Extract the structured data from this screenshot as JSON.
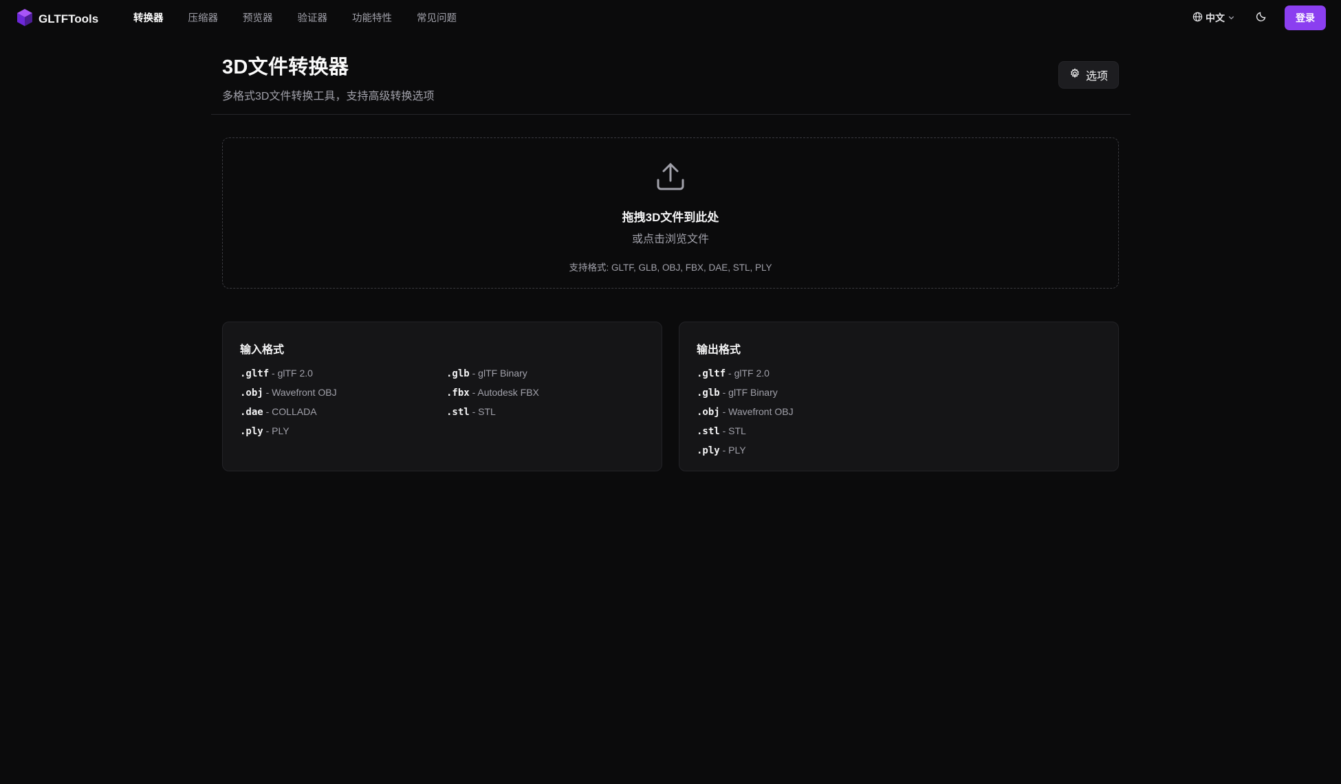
{
  "nav": {
    "brand": "GLTFTools",
    "links": [
      "转换器",
      "压缩器",
      "预览器",
      "验证器",
      "功能特性",
      "常见问题"
    ],
    "language": "中文",
    "login": "登录"
  },
  "header": {
    "title": "3D文件转换器",
    "subtitle": "多格式3D文件转换工具，支持高级转换选项",
    "options_label": "选项"
  },
  "dropzone": {
    "title": "拖拽3D文件到此处",
    "subtitle": "或点击浏览文件",
    "formats": "支持格式: GLTF, GLB, OBJ, FBX, DAE, STL, PLY"
  },
  "input_formats": {
    "title": "输入格式",
    "items": [
      {
        "ext": ".gltf",
        "desc": "glTF 2.0"
      },
      {
        "ext": ".glb",
        "desc": "glTF Binary"
      },
      {
        "ext": ".obj",
        "desc": "Wavefront OBJ"
      },
      {
        "ext": ".fbx",
        "desc": "Autodesk FBX"
      },
      {
        "ext": ".dae",
        "desc": "COLLADA"
      },
      {
        "ext": ".stl",
        "desc": "STL"
      },
      {
        "ext": ".ply",
        "desc": "PLY"
      }
    ]
  },
  "output_formats": {
    "title": "输出格式",
    "items": [
      {
        "ext": ".gltf",
        "desc": "glTF 2.0"
      },
      {
        "ext": ".glb",
        "desc": "glTF Binary"
      },
      {
        "ext": ".obj",
        "desc": "Wavefront OBJ"
      },
      {
        "ext": ".stl",
        "desc": "STL"
      },
      {
        "ext": ".ply",
        "desc": "PLY"
      }
    ]
  },
  "icons": {
    "logo": "cube-logo-icon",
    "language": "globe-icon",
    "dropdown": "chevron-down-icon",
    "theme": "moon-icon",
    "options": "gear-icon",
    "upload": "upload-icon"
  },
  "colors": {
    "background": "#0b0b0c",
    "accent": "#8b3ff0",
    "card": "#151517"
  }
}
